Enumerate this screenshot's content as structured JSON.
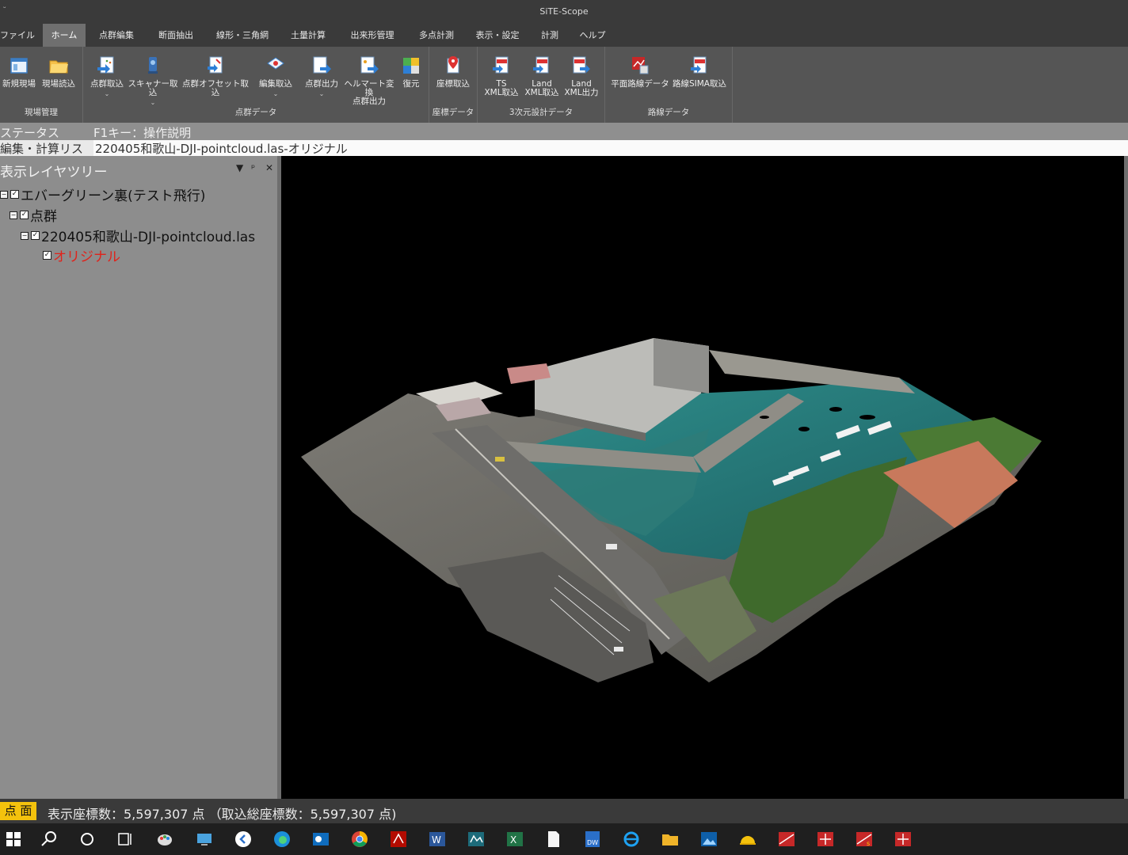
{
  "app": {
    "title": "SiTE-Scope",
    "system_icon": "window-menu-icon"
  },
  "tabs": [
    {
      "label": "ファイル",
      "active": false
    },
    {
      "label": "ホーム",
      "active": true
    },
    {
      "label": "点群編集",
      "active": false
    },
    {
      "label": "断面抽出",
      "active": false
    },
    {
      "label": "線形・三角網",
      "active": false
    },
    {
      "label": "土量計算",
      "active": false
    },
    {
      "label": "出来形管理",
      "active": false
    },
    {
      "label": "多点計測",
      "active": false
    },
    {
      "label": "表示・設定",
      "active": false
    },
    {
      "label": "計測",
      "active": false
    },
    {
      "label": "ヘルプ",
      "active": false
    }
  ],
  "ribbon": {
    "groups": [
      {
        "label": "現場管理",
        "buttons": [
          {
            "label": "新規現場",
            "icon": "new-site-icon"
          },
          {
            "label": "現場読込",
            "icon": "open-folder-icon"
          }
        ]
      },
      {
        "label": "点群データ",
        "buttons": [
          {
            "label": "点群取込",
            "icon": "pointcloud-import-icon",
            "dropdown": true
          },
          {
            "label": "スキャナー取込",
            "icon": "scanner-import-icon",
            "dropdown": true
          },
          {
            "label": "点群オフセット取込",
            "icon": "offset-import-icon"
          },
          {
            "label": "編集取込",
            "icon": "edit-import-icon",
            "dropdown": true
          },
          {
            "label": "点群出力",
            "icon": "pointcloud-export-icon",
            "dropdown": true
          },
          {
            "label": "ヘルマート変換\n点群出力",
            "icon": "helmert-export-icon"
          },
          {
            "label": "復元",
            "icon": "restore-icon"
          }
        ]
      },
      {
        "label": "座標データ",
        "buttons": [
          {
            "label": "座標取込",
            "icon": "coordinate-import-icon"
          }
        ]
      },
      {
        "label": "3次元設計データ",
        "buttons": [
          {
            "label": "TS\nXML取込",
            "icon": "ts-xml-import-icon"
          },
          {
            "label": "Land\nXML取込",
            "icon": "landxml-import-icon"
          },
          {
            "label": "Land\nXML出力",
            "icon": "landxml-export-icon"
          }
        ]
      },
      {
        "label": "路線データ",
        "buttons": [
          {
            "label": "平面路線データ",
            "icon": "plan-route-data-icon"
          },
          {
            "label": "路線SIMA取込",
            "icon": "route-sima-import-icon"
          }
        ]
      }
    ]
  },
  "status": {
    "label": "ステータス",
    "hint": "F1キー：操作説明"
  },
  "edit_list": {
    "label": "編集・計算リス",
    "value": "220405和歌山-DJI-pointcloud.las-オリジナル"
  },
  "layer_panel": {
    "title": "表示レイヤツリー",
    "controls": [
      "▼",
      "ᵖ",
      "✕"
    ],
    "tree": [
      {
        "label": "エバーグリーン裏(テスト飛行)",
        "level": 0,
        "expand": "−",
        "checked": true,
        "color": "#111111"
      },
      {
        "label": "点群",
        "level": 1,
        "expand": "−",
        "checked": true,
        "color": "#111111"
      },
      {
        "label": "220405和歌山-DJI-pointcloud.las",
        "level": 2,
        "expand": "−",
        "checked": true,
        "color": "#111111"
      },
      {
        "label": "オリジナル",
        "level": 3,
        "expand": "",
        "checked": true,
        "color": "#e0231b"
      }
    ]
  },
  "bottom": {
    "mode_label": "点 面",
    "coords_text": "表示座標数：5,597,307 点 （取込総座標数：5,597,307 点)"
  },
  "taskbar": [
    {
      "name": "windows-start-icon",
      "running": false
    },
    {
      "name": "search-icon",
      "running": false
    },
    {
      "name": "cortana-icon",
      "running": false
    },
    {
      "name": "task-view-icon",
      "running": false
    },
    {
      "name": "paint-icon",
      "running": false
    },
    {
      "name": "remote-icon",
      "running": false
    },
    {
      "name": "back-arrow-app-icon",
      "running": false
    },
    {
      "name": "edge-icon",
      "running": true
    },
    {
      "name": "outlook-icon",
      "running": true
    },
    {
      "name": "chrome-icon",
      "running": true
    },
    {
      "name": "acrobat-icon",
      "running": true
    },
    {
      "name": "word-icon",
      "running": false
    },
    {
      "name": "app-icon",
      "running": false
    },
    {
      "name": "excel-icon",
      "running": false
    },
    {
      "name": "document-icon",
      "running": false
    },
    {
      "name": "docuworks-icon",
      "running": false
    },
    {
      "name": "internet-explorer-icon",
      "running": false
    },
    {
      "name": "file-explorer-icon",
      "running": true
    },
    {
      "name": "photos-icon",
      "running": false
    },
    {
      "name": "helmet-icon",
      "running": false
    },
    {
      "name": "site-app-1-icon",
      "running": false
    },
    {
      "name": "site-app-2-icon",
      "running": false
    },
    {
      "name": "site-app-3-icon",
      "running": false
    },
    {
      "name": "site-scope-icon",
      "running": true
    }
  ]
}
